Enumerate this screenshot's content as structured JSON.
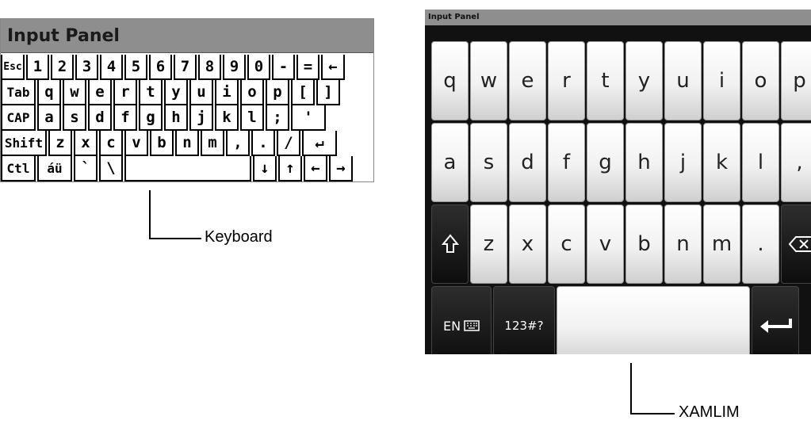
{
  "left_panel": {
    "title": "Input Panel",
    "rows": [
      [
        "Esc",
        "1",
        "2",
        "3",
        "4",
        "5",
        "6",
        "7",
        "8",
        "9",
        "0",
        "-",
        "=",
        "←"
      ],
      [
        "Tab",
        "q",
        "w",
        "e",
        "r",
        "t",
        "y",
        "u",
        "i",
        "o",
        "p",
        "[",
        "]"
      ],
      [
        "CAP",
        "a",
        "s",
        "d",
        "f",
        "g",
        "h",
        "j",
        "k",
        "l",
        ";",
        "'"
      ],
      [
        "Shift",
        "z",
        "x",
        "c",
        "v",
        "b",
        "n",
        "m",
        ",",
        ".",
        "/",
        "↵"
      ],
      [
        "Ctl",
        "áü",
        "`",
        "\\",
        "",
        "↓",
        "↑",
        "←",
        "→"
      ]
    ]
  },
  "left_callout": {
    "label": "Keyboard"
  },
  "right_panel": {
    "title": "Input Panel",
    "row1": [
      "q",
      "w",
      "e",
      "r",
      "t",
      "y",
      "u",
      "i",
      "o",
      "p"
    ],
    "row2": [
      "a",
      "s",
      "d",
      "f",
      "g",
      "h",
      "j",
      "k",
      "l",
      ","
    ],
    "row3": {
      "shift_icon": "shift-icon",
      "keys": [
        "z",
        "x",
        "c",
        "v",
        "b",
        "n",
        "m",
        "."
      ],
      "backspace_icon": "backspace-icon"
    },
    "row4": {
      "lang_label": "EN",
      "keyboard_icon": "keyboard-icon",
      "num_label": "123#?",
      "space_label": "",
      "enter_icon": "enter-icon"
    }
  },
  "right_callout": {
    "label": "XAMLIM"
  }
}
